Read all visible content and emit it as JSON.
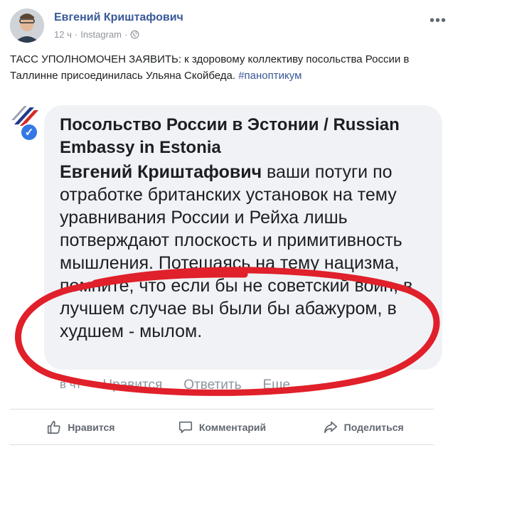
{
  "post": {
    "author": "Евгений Криштафович",
    "time": "12 ч",
    "source": "Instagram",
    "separator": "·",
    "more_glyph": "•••",
    "text_main": "ТАСС УПОЛНОМОЧЕН ЗАЯВИТЬ: к здоровому коллективу посольства России в Таллинне присоединилась Ульяна Скойбеда. ",
    "hashtag": "#паноптикум"
  },
  "screenshot": {
    "page_name": "Посольство России в Эстонии / Russian Embassy in Estonia",
    "reply_to": "Евгений Криштафович",
    "reply_text": " ваши потуги по отработке британских установок на тему уравнивания России и Рейха лишь потверждают плоскость и примитивность мышления. Потешаясь на тему нацизма, помните, что если бы не советский воин, в лучшем случае вы были бы абажуром, в худшем - мылом.",
    "comment_time": "в чт",
    "comment_like": "Нравится",
    "comment_reply": "Ответить",
    "comment_more": "Еще",
    "verified_glyph": "✓"
  },
  "actions": {
    "like": "Нравится",
    "comment": "Комментарий",
    "share": "Поделиться"
  },
  "colors": {
    "link": "#385898",
    "annotation": "#e0202a",
    "verified": "#3578e5"
  }
}
